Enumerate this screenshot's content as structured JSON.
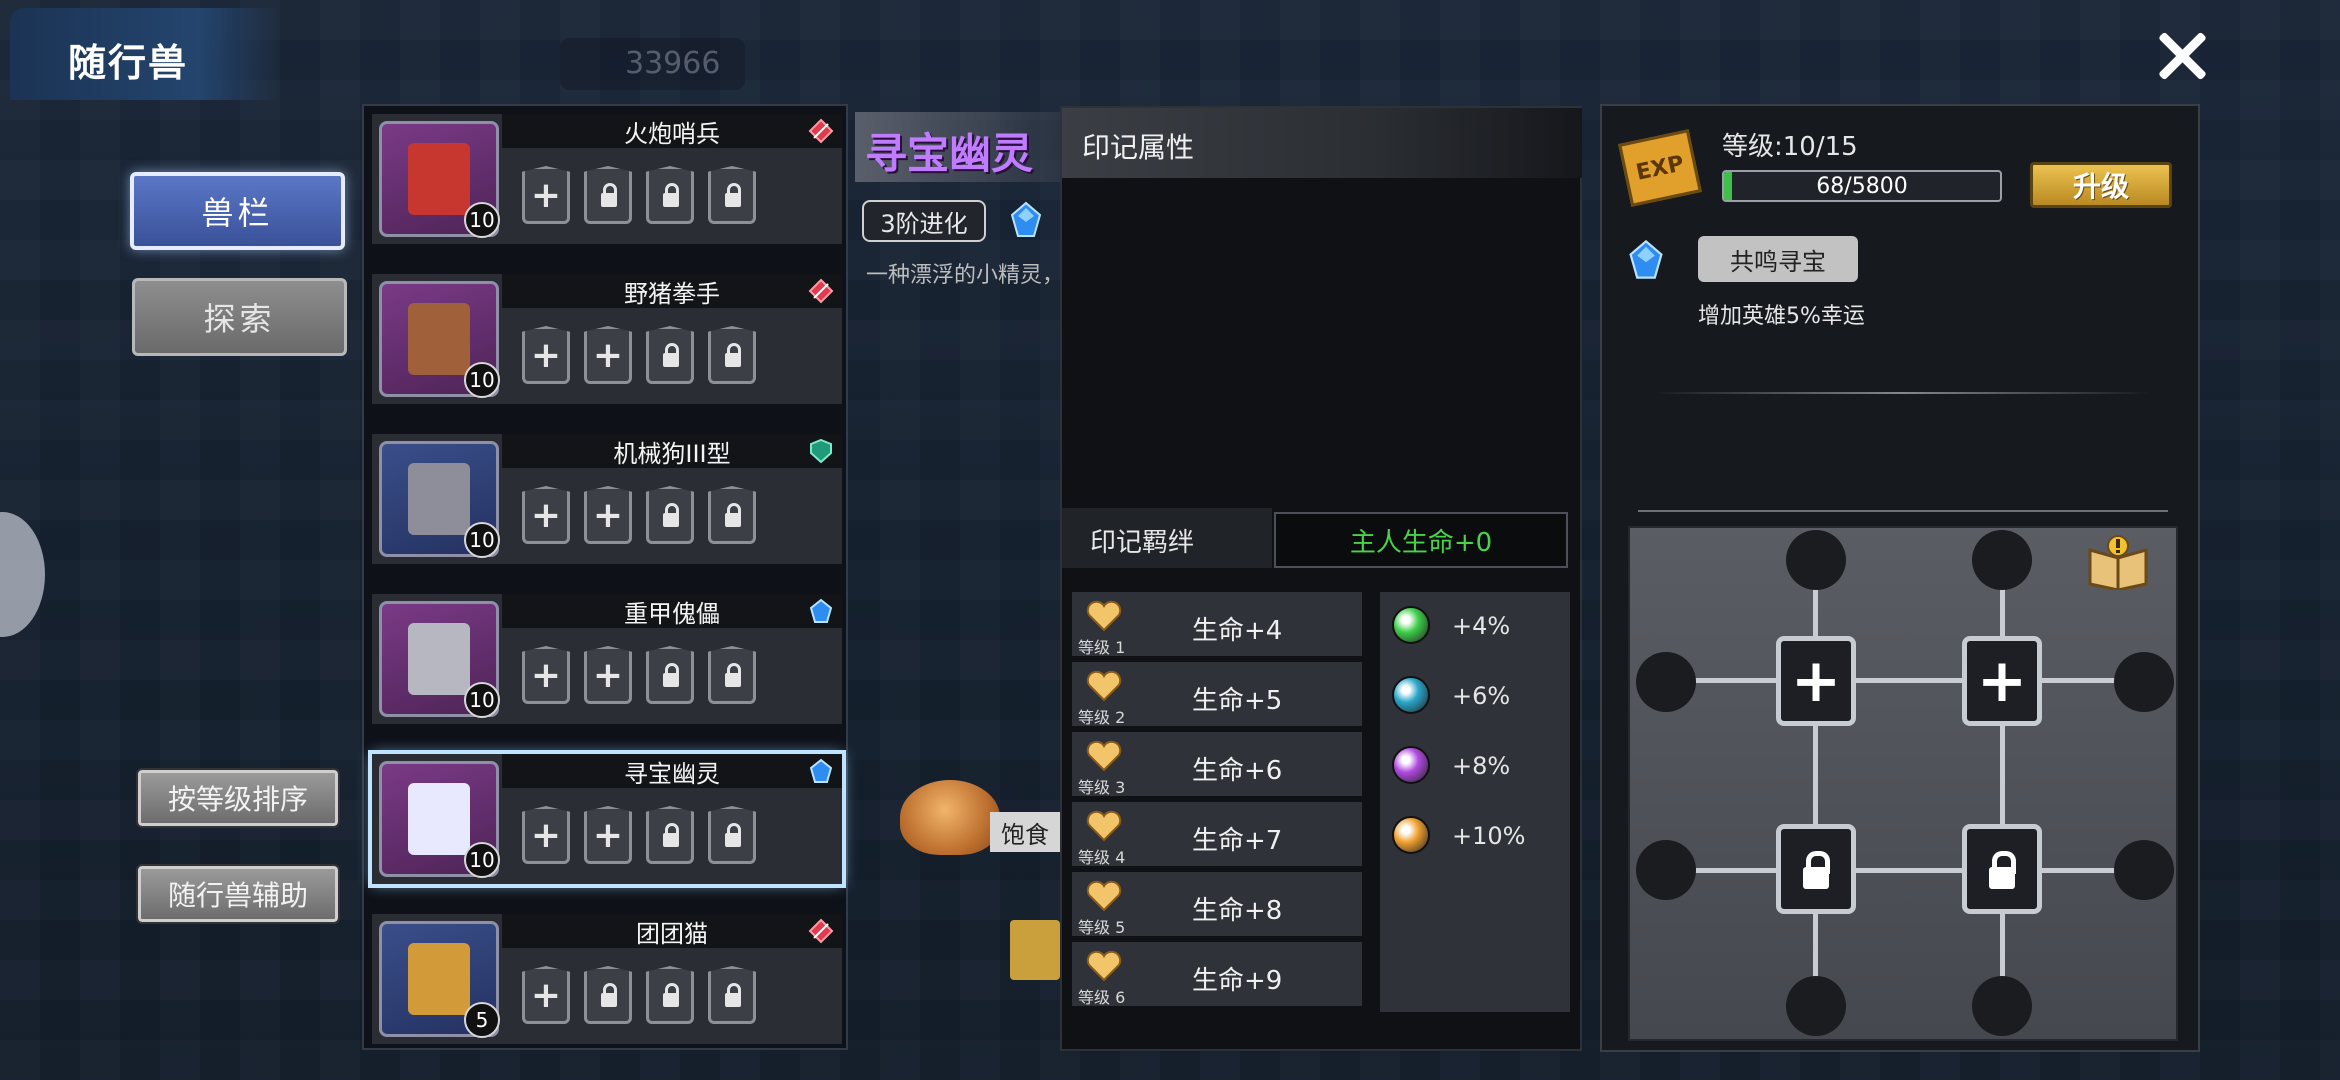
{
  "header": {
    "title": "随行兽",
    "bg_counter": "33966"
  },
  "nav": {
    "tab_pets": "兽栏",
    "tab_explore": "探索"
  },
  "buttons": {
    "sort_by_level": "按等级排序",
    "pet_assist": "随行兽辅助"
  },
  "pets": [
    {
      "name": "火炮哨兵",
      "level": "10",
      "gem_icon": "red-rune-icon",
      "slots": [
        "plus",
        "lock",
        "lock",
        "lock"
      ],
      "bg": "purple",
      "sprite_color": "#c8372f"
    },
    {
      "name": "野猪拳手",
      "level": "10",
      "gem_icon": "red-rune-icon",
      "slots": [
        "plus",
        "plus",
        "lock",
        "lock"
      ],
      "bg": "purple",
      "sprite_color": "#a0603a"
    },
    {
      "name": "机械狗III型",
      "level": "10",
      "gem_icon": "green-shield-icon",
      "slots": [
        "plus",
        "plus",
        "lock",
        "lock"
      ],
      "bg": "blue",
      "sprite_color": "#8e8e9a"
    },
    {
      "name": "重甲傀儡",
      "level": "10",
      "gem_icon": "blue-crystal-icon",
      "slots": [
        "plus",
        "plus",
        "lock",
        "lock"
      ],
      "bg": "purple",
      "sprite_color": "#b7b7c2"
    },
    {
      "name": "寻宝幽灵",
      "level": "10",
      "gem_icon": "blue-crystal-icon",
      "slots": [
        "plus",
        "plus",
        "lock",
        "lock"
      ],
      "bg": "purple",
      "sprite_color": "#e8e8ff",
      "selected": true
    },
    {
      "name": "团团猫",
      "level": "5",
      "gem_icon": "red-rune-icon",
      "slots": [
        "plus",
        "lock",
        "lock",
        "lock"
      ],
      "bg": "blue",
      "sprite_color": "#d39a3a"
    }
  ],
  "detail": {
    "name": "寻宝幽灵",
    "evolution": "3阶进化",
    "description": "一种漂浮的小精灵，好像具备找到稀有宝物的能力",
    "food_label": "饱食"
  },
  "seal": {
    "attr_title": "印记属性",
    "bond_title": "印记羁绊",
    "bond_value": "主人生命+0",
    "rows": [
      {
        "level": "等级 1",
        "value": "生命+4"
      },
      {
        "level": "等级 2",
        "value": "生命+5"
      },
      {
        "level": "等级 3",
        "value": "生命+6"
      },
      {
        "level": "等级 4",
        "value": "生命+7"
      },
      {
        "level": "等级 5",
        "value": "生命+8"
      },
      {
        "level": "等级 6",
        "value": "生命+9"
      }
    ],
    "bonuses": [
      {
        "pct": "+4%",
        "color": "#3ecf4a"
      },
      {
        "pct": "+6%",
        "color": "#2aa6c9"
      },
      {
        "pct": "+8%",
        "color": "#b04ae0"
      },
      {
        "pct": "+10%",
        "color": "#f0a030"
      }
    ]
  },
  "right": {
    "exp_badge": "EXP",
    "level_label": "等级:10/15",
    "xp_text": "68/5800",
    "xp_fraction": 0.0117,
    "upgrade_label": "升级",
    "skill_name": "共鸣寻宝",
    "skill_desc": "增加英雄5%幸运"
  },
  "colors": {
    "accent_purple": "#c07cff",
    "bond_green": "#4ad34a",
    "xp_green": "#3fc04a"
  }
}
